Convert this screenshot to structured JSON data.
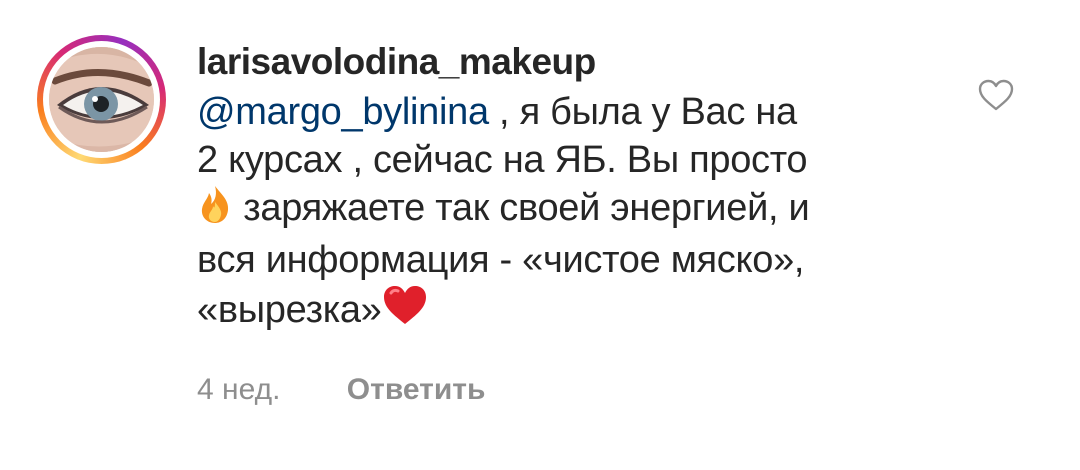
{
  "comment": {
    "username": "larisavolodina_makeup",
    "mention": "@margo_bylinina",
    "text_parts": [
      " , я была у Вас на",
      "2 курсах , сейчас на ЯБ. Вы просто",
      " заряжаете так своей энергией, и",
      "вся информация - «чистое мяско»,",
      "«вырезка»"
    ],
    "emojis": [
      "fire-emoji",
      "heart-emoji"
    ],
    "time": "4 нед.",
    "reply_label": "Ответить"
  },
  "icons": {
    "like": "heart-outline-icon"
  },
  "colors": {
    "username": "#262626",
    "mention": "#00376b",
    "meta": "#8e8e8e",
    "heart_emoji": "#e0202b",
    "fire_emoji": "#f7931e"
  }
}
